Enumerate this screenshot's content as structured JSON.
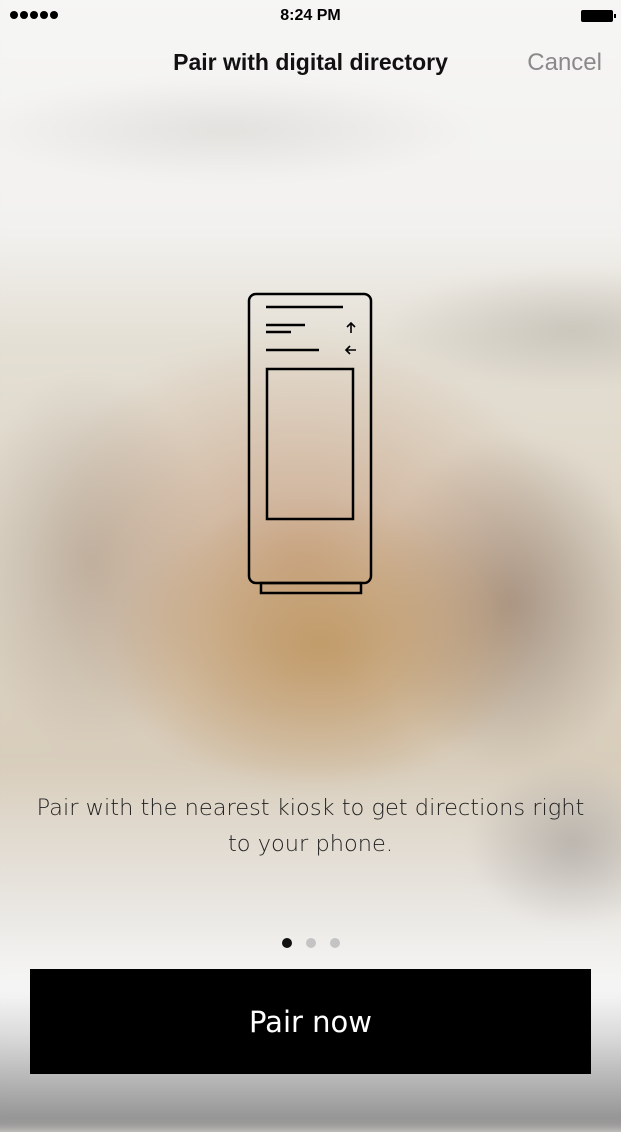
{
  "status_bar": {
    "time": "8:24 PM",
    "signal_bars": 5
  },
  "nav": {
    "title": "Pair with digital directory",
    "cancel_label": "Cancel"
  },
  "illustration": {
    "icon": "kiosk-icon"
  },
  "description": "Pair with the nearest kiosk to get directions right to your phone.",
  "pager": {
    "count": 3,
    "active_index": 0
  },
  "primary_button": {
    "label": "Pair now"
  },
  "colors": {
    "button_bg": "#000000",
    "button_text": "#ffffff",
    "cancel": "#8a8a8a",
    "active_dot": "#111111",
    "inactive_dot": "#c4c4c4"
  }
}
